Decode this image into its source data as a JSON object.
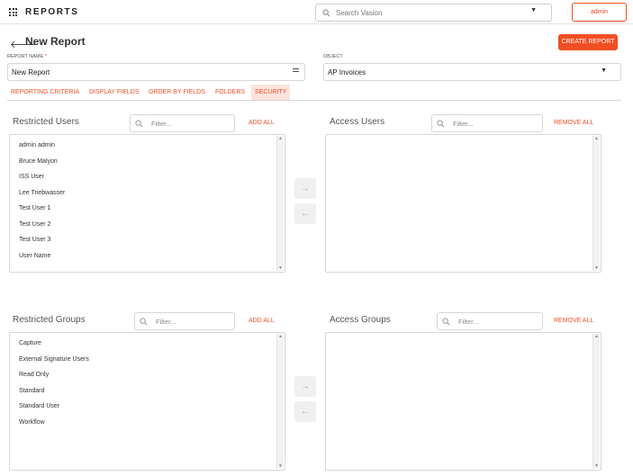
{
  "header": {
    "brand": "REPORTS",
    "search_placeholder": "Search Vasion",
    "user_label": "admin"
  },
  "page": {
    "title": "New Report",
    "create_label": "CREATE REPORT"
  },
  "form": {
    "report_name_label": "REPORT NAME",
    "report_name_required": "*",
    "report_name_value": "New Report",
    "object_label": "OBJECT",
    "object_value": "AP Invoices"
  },
  "tabs": [
    {
      "label": "REPORTING CRITERIA",
      "active": false
    },
    {
      "label": "DISPLAY FIELDS",
      "active": false
    },
    {
      "label": "ORDER BY FIELDS",
      "active": false
    },
    {
      "label": "FOLDERS",
      "active": false
    },
    {
      "label": "SECURITY",
      "active": true
    }
  ],
  "users": {
    "restricted_title": "Restricted Users",
    "access_title": "Access Users",
    "filter_placeholder": "Filter...",
    "add_all_label": "ADD ALL",
    "remove_all_label": "REMOVE ALL",
    "restricted_items": [
      "admin admin",
      "Bruce Malyon",
      "ISS User",
      "Lee Triebwasser",
      "Test User 1",
      "Test User 2",
      "Test User 3",
      "User Name"
    ],
    "access_items": []
  },
  "groups": {
    "restricted_title": "Restricted Groups",
    "access_title": "Access Groups",
    "filter_placeholder": "Filter...",
    "add_all_label": "ADD ALL",
    "remove_all_label": "REMOVE ALL",
    "restricted_items": [
      "Capture",
      "External Signature Users",
      "Read Only",
      "Standard",
      "Standard User",
      "Workflow"
    ],
    "access_items": []
  },
  "icons": {
    "menu": "grid-icon",
    "search": "search-icon",
    "back": "arrow-left-icon",
    "move_right": "arrow-right-icon",
    "move_left": "arrow-left-icon"
  },
  "colors": {
    "accent": "#f04e23",
    "active_tab_bg": "#fde3dc"
  }
}
